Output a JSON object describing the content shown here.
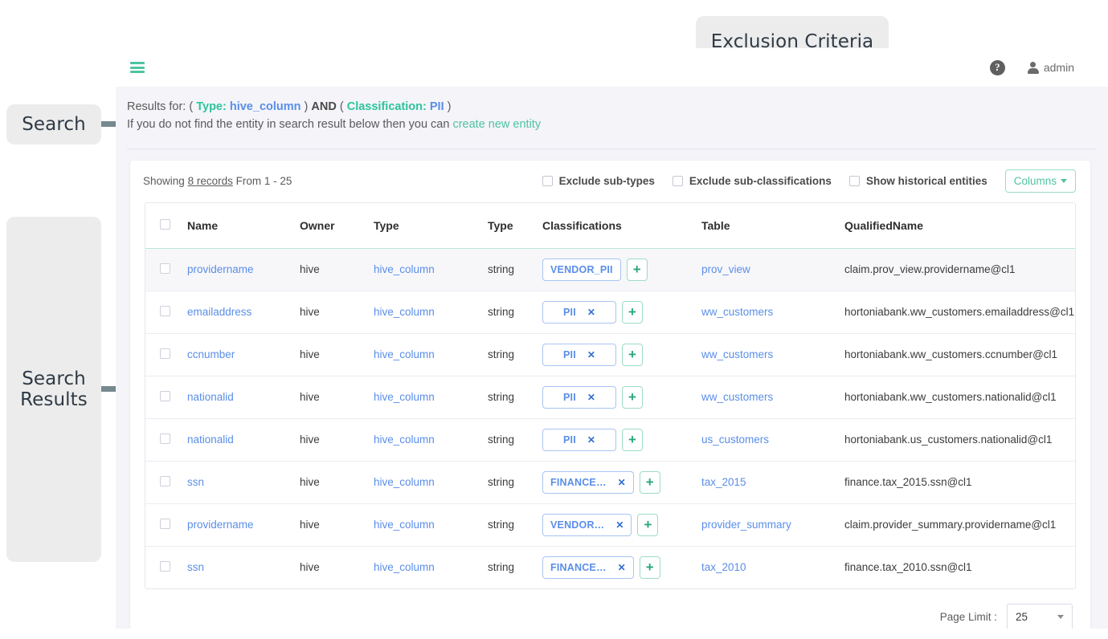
{
  "annotations": {
    "search_label": "Search",
    "search_results_label": "Search\nResults",
    "search_results_line1": "Search",
    "search_results_line2": "Results",
    "exclusion_label": "Exclusion Criteria"
  },
  "topbar": {
    "menu_icon": "hamburger-icon",
    "help_icon": "help-icon",
    "help_glyph": "?",
    "user_icon": "user-icon",
    "user_name": "admin"
  },
  "search_summary": {
    "prefix": "Results for: (",
    "type_key": "Type:",
    "type_value": "hive_column",
    "close_paren_1": ")",
    "and": "AND",
    "open_paren_2": "(",
    "classification_key": "Classification:",
    "classification_value": "PII",
    "close_paren_2": ")",
    "hint_prefix": "If you do not find the entity in search result below then you can",
    "hint_link": "create new entity"
  },
  "toolbar": {
    "showing_prefix": "Showing",
    "showing_records": "8 records",
    "showing_suffix": "From 1 - 25",
    "exclude_subtypes": "Exclude sub-types",
    "exclude_subclassifications": "Exclude sub-classifications",
    "show_historical": "Show historical entities",
    "columns_button": "Columns"
  },
  "table": {
    "headers": [
      "Name",
      "Owner",
      "Type",
      "Type",
      "Classifications",
      "Table",
      "QualifiedName"
    ],
    "rows": [
      {
        "name": "providername",
        "owner": "hive",
        "type1": "hive_column",
        "type2": "string",
        "tag": "VENDOR_PII",
        "tag_removable": false,
        "table": "prov_view",
        "qualified_name": "claim.prov_view.providername@cl1"
      },
      {
        "name": "emailaddress",
        "owner": "hive",
        "type1": "hive_column",
        "type2": "string",
        "tag": "PII",
        "tag_removable": true,
        "table": "ww_customers",
        "qualified_name": "hortoniabank.ww_customers.emailaddress@cl1"
      },
      {
        "name": "ccnumber",
        "owner": "hive",
        "type1": "hive_column",
        "type2": "string",
        "tag": "PII",
        "tag_removable": true,
        "table": "ww_customers",
        "qualified_name": "hortoniabank.ww_customers.ccnumber@cl1"
      },
      {
        "name": "nationalid",
        "owner": "hive",
        "type1": "hive_column",
        "type2": "string",
        "tag": "PII",
        "tag_removable": true,
        "table": "ww_customers",
        "qualified_name": "hortoniabank.ww_customers.nationalid@cl1"
      },
      {
        "name": "nationalid",
        "owner": "hive",
        "type1": "hive_column",
        "type2": "string",
        "tag": "PII",
        "tag_removable": true,
        "table": "us_customers",
        "qualified_name": "hortoniabank.us_customers.nationalid@cl1"
      },
      {
        "name": "ssn",
        "owner": "hive",
        "type1": "hive_column",
        "type2": "string",
        "tag": "FINANCE…",
        "tag_removable": true,
        "table": "tax_2015",
        "qualified_name": "finance.tax_2015.ssn@cl1"
      },
      {
        "name": "providername",
        "owner": "hive",
        "type1": "hive_column",
        "type2": "string",
        "tag": "VENDOR…",
        "tag_removable": true,
        "table": "provider_summary",
        "qualified_name": "claim.provider_summary.providername@cl1"
      },
      {
        "name": "ssn",
        "owner": "hive",
        "type1": "hive_column",
        "type2": "string",
        "tag": "FINANCE…",
        "tag_removable": true,
        "table": "tax_2010",
        "qualified_name": "finance.tax_2010.ssn@cl1"
      }
    ]
  },
  "footer": {
    "page_limit_label": "Page Limit :",
    "page_limit_value": "25"
  },
  "colors": {
    "accent_green": "#4fc3a1",
    "link_blue": "#5a8ee8",
    "annotation_gray": "#75898f",
    "panel_bg": "#f4f4f9"
  }
}
